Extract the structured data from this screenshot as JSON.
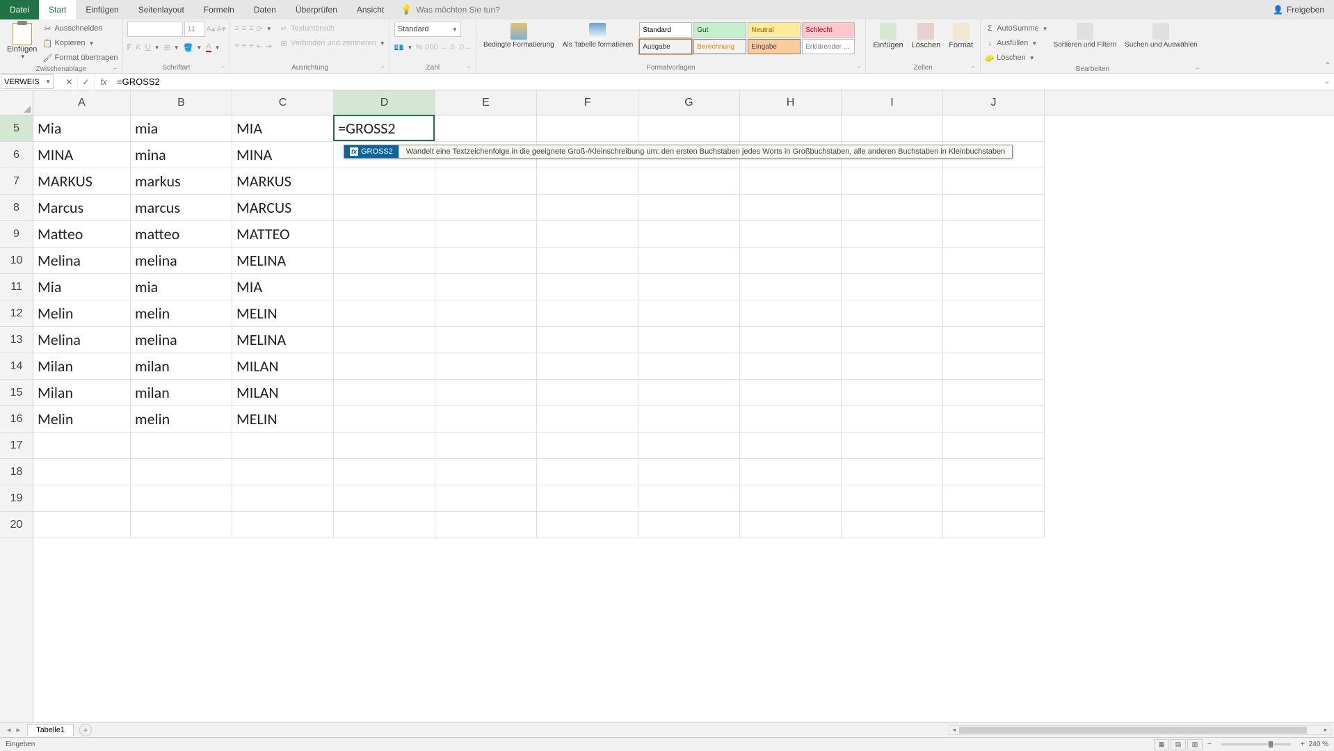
{
  "titlebar": {
    "file_tab": "Datei",
    "tabs": [
      "Start",
      "Einfügen",
      "Seitenlayout",
      "Formeln",
      "Daten",
      "Überprüfen",
      "Ansicht"
    ],
    "active_tab_index": 0,
    "search_placeholder": "Was möchten Sie tun?",
    "share": "Freigeben"
  },
  "ribbon": {
    "clipboard": {
      "label": "Zwischenablage",
      "paste": "Einfügen",
      "cut": "Ausschneiden",
      "copy": "Kopieren",
      "format_painter": "Format übertragen"
    },
    "font": {
      "label": "Schriftart",
      "name": "",
      "size": "11"
    },
    "alignment": {
      "label": "Ausrichtung",
      "wrap": "Textumbruch",
      "merge": "Verbinden und zentrieren"
    },
    "number": {
      "label": "Zahl",
      "format": "Standard"
    },
    "styles": {
      "label": "Formatvorlagen",
      "conditional": "Bedingte Formatierung",
      "as_table": "Als Tabelle formatieren",
      "items": [
        {
          "name": "Standard",
          "bg": "#fff",
          "fg": "#000",
          "border": "#bbb"
        },
        {
          "name": "Gut",
          "bg": "#c6efce",
          "fg": "#006100",
          "border": "#bbb"
        },
        {
          "name": "Neutral",
          "bg": "#ffeb9c",
          "fg": "#9c5700",
          "border": "#bbb"
        },
        {
          "name": "Schlecht",
          "bg": "#ffc7ce",
          "fg": "#9c0006",
          "border": "#bbb"
        },
        {
          "name": "Ausgabe",
          "bg": "#f2f2f2",
          "fg": "#3f3f3f",
          "border": "#7f7f7f"
        },
        {
          "name": "Berechnung",
          "bg": "#f2f2f2",
          "fg": "#fa7d00",
          "border": "#7f7f7f"
        },
        {
          "name": "Eingabe",
          "bg": "#ffcc99",
          "fg": "#3f3f76",
          "border": "#7f7f7f"
        },
        {
          "name": "Erklärender ...",
          "bg": "#fff",
          "fg": "#7f7f7f",
          "border": "#bbb"
        }
      ]
    },
    "cells": {
      "label": "Zellen",
      "insert": "Einfügen",
      "delete": "Löschen",
      "format": "Format"
    },
    "editing": {
      "label": "Bearbeiten",
      "autosum": "AutoSumme",
      "fill": "Ausfüllen",
      "clear": "Löschen",
      "sort": "Sortieren und Filtern",
      "find": "Suchen und Auswählen"
    }
  },
  "formula_bar": {
    "name_box": "VERWEIS",
    "formula": "=GROSS2"
  },
  "grid": {
    "columns": [
      "A",
      "B",
      "C",
      "D",
      "E",
      "F",
      "G",
      "H",
      "I",
      "J"
    ],
    "row_start": 5,
    "row_end": 20,
    "active_col": "D",
    "active_row": 5,
    "data": {
      "5": {
        "A": "Mia",
        "B": "mia",
        "C": "MIA",
        "D": "=GROSS2"
      },
      "6": {
        "A": "MINA",
        "B": "mina",
        "C": "MINA"
      },
      "7": {
        "A": "MARKUS",
        "B": "markus",
        "C": "MARKUS"
      },
      "8": {
        "A": "Marcus",
        "B": "marcus",
        "C": "MARCUS"
      },
      "9": {
        "A": "Matteo",
        "B": "matteo",
        "C": "MATTEO"
      },
      "10": {
        "A": "Melina",
        "B": "melina",
        "C": "MELINA"
      },
      "11": {
        "A": "Mia",
        "B": "mia",
        "C": "MIA"
      },
      "12": {
        "A": "Melin",
        "B": "melin",
        "C": "MELIN"
      },
      "13": {
        "A": "Melina",
        "B": "melina",
        "C": "MELINA"
      },
      "14": {
        "A": "Milan",
        "B": "milan",
        "C": "MILAN"
      },
      "15": {
        "A": "Milan",
        "B": "milan",
        "C": "MILAN"
      },
      "16": {
        "A": "Melin",
        "B": "melin",
        "C": "MELIN"
      }
    },
    "autocomplete": {
      "func": "GROSS2",
      "desc": "Wandelt eine Textzeichenfolge in die geeignete Groß-/Kleinschreibung um: den ersten Buchstaben jedes Worts in Großbuchstaben, alle anderen Buchstaben in Kleinbuchstaben"
    }
  },
  "sheet_bar": {
    "sheet_name": "Tabelle1"
  },
  "status_bar": {
    "mode": "Eingeben",
    "zoom": "240 %"
  }
}
